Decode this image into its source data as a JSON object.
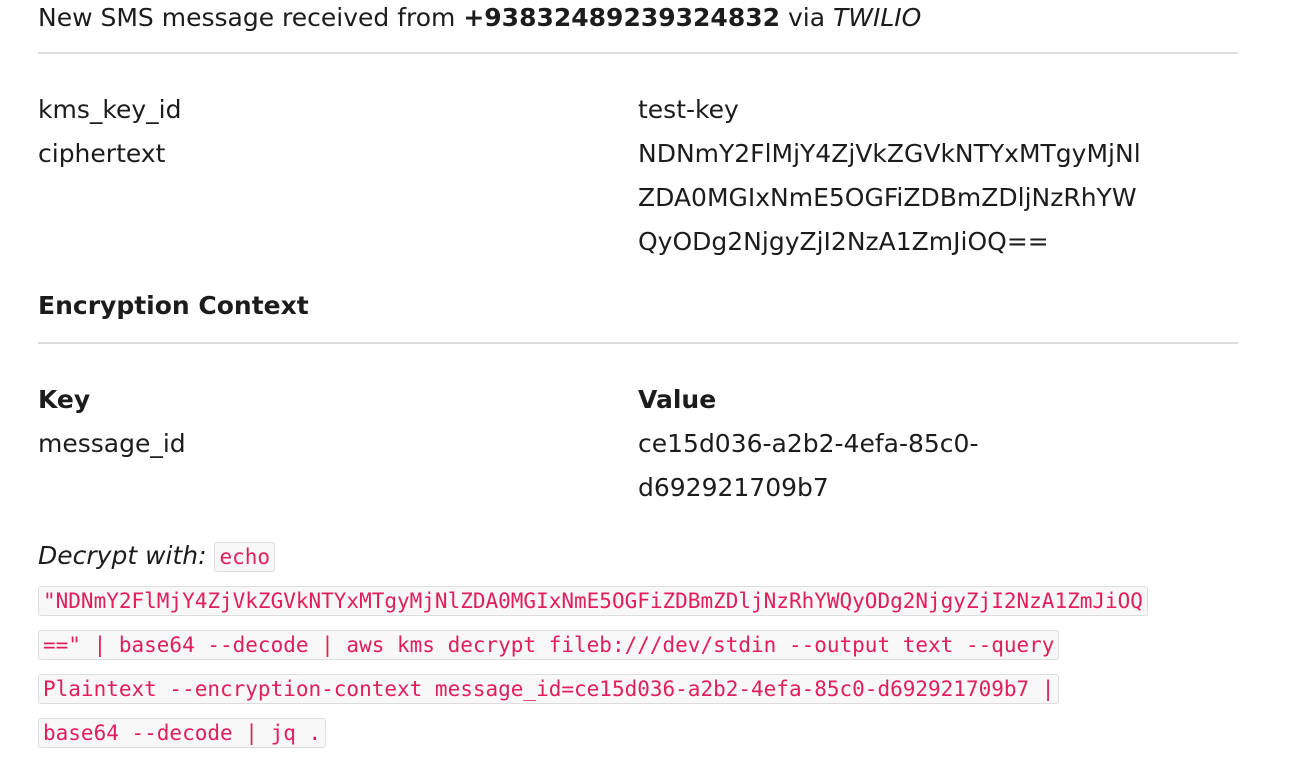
{
  "message": {
    "prefix": "New SMS message received from ",
    "phone": "+93832489239324832",
    "via": " via ",
    "provider": "TWILIO"
  },
  "fields": {
    "kms_key_id_label": "kms_key_id",
    "kms_key_id_value": "test-key",
    "ciphertext_label": "ciphertext",
    "ciphertext_lines": [
      "NDNmY2FlMjY4ZjVkZGVkNTYxMTgyMjNl",
      "ZDA0MGIxNmE5OGFiZDBmZDljNzRhYW",
      "QyODg2NjgyZjI2NzA1ZmJiOQ=="
    ]
  },
  "encryption_context": {
    "heading": "Encryption Context",
    "key_header": "Key",
    "value_header": "Value",
    "rows": [
      {
        "key": "message_id",
        "value_lines": [
          "ce15d036-a2b2-4efa-85c0-",
          "d692921709b7"
        ]
      }
    ]
  },
  "decrypt": {
    "label": "Decrypt with:",
    "code_lines": [
      "echo",
      "\"NDNmY2FlMjY4ZjVkZGVkNTYxMTgyMjNlZDA0MGIxNmE5OGFiZDBmZDljNzRhYWQyODg2NjgyZjI2NzA1ZmJiOQ",
      "==\" | base64 --decode | aws kms decrypt fileb:///dev/stdin --output text --query",
      "Plaintext --encryption-context  message_id=ce15d036-a2b2-4efa-85c0-d692921709b7 |",
      "base64 --decode | jq ."
    ]
  },
  "colors": {
    "code_text": "#e01e5a",
    "code_bg": "#f8f8f8",
    "rule": "#dddddd"
  }
}
